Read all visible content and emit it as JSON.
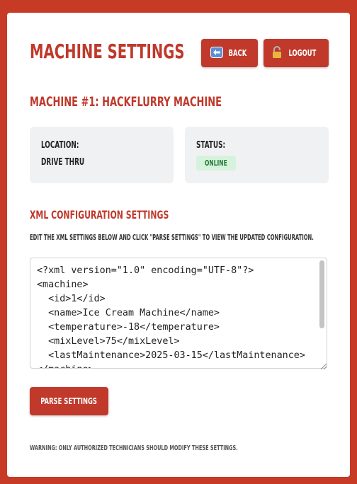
{
  "header": {
    "title": "Machine Settings",
    "back_label": "Back",
    "back_icon": "back-arrow-icon",
    "logout_label": "Logout",
    "logout_icon": "padlock-icon"
  },
  "machine": {
    "title": "Machine #1: HackFlurry Machine",
    "location_label": "Location:",
    "location_value": "Drive Thru",
    "status_label": "Status:",
    "status_value": "Online"
  },
  "xml_section": {
    "title": "XML Configuration Settings",
    "instructions": "Edit the XML settings below and click \"Parse Settings\" to view the updated configuration.",
    "content": "<?xml version=\"1.0\" encoding=\"UTF-8\"?>\n<machine>\n  <id>1</id>\n  <name>Ice Cream Machine</name>\n  <temperature>-18</temperature>\n  <mixLevel>75</mixLevel>\n  <lastMaintenance>2025-03-15</lastMaintenance>\n</machine>",
    "parse_label": "Parse Settings"
  },
  "footer": {
    "warning": "Warning: Only authorized technicians should modify these settings."
  },
  "colors": {
    "background": "#c73a25",
    "accent": "#c0392b",
    "badge_bg": "#d7f2dc",
    "badge_text": "#1f7a34"
  }
}
